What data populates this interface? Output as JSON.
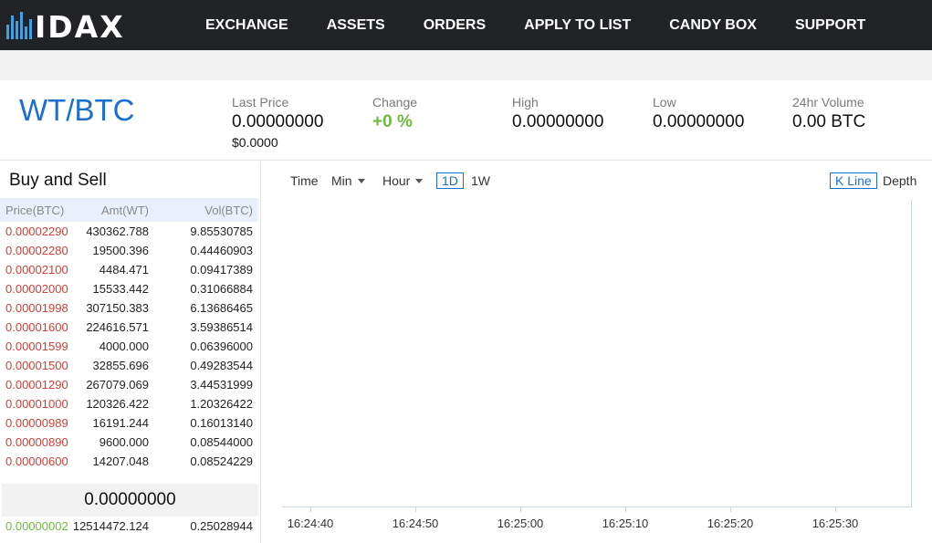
{
  "nav": {
    "logo": "IDAX",
    "items": [
      "EXCHANGE",
      "ASSETS",
      "ORDERS",
      "APPLY TO LIST",
      "CANDY BOX",
      "SUPPORT"
    ]
  },
  "ticker": {
    "pair": "WT/BTC",
    "last_price_label": "Last Price",
    "last_price": "0.00000000",
    "last_price_usd": "$0.0000",
    "change_label": "Change",
    "change": "+0 %",
    "high_label": "High",
    "high": "0.00000000",
    "low_label": "Low",
    "low": "0.00000000",
    "volume_label": "24hr Volume",
    "volume": "0.00 BTC"
  },
  "book": {
    "title": "Buy and Sell",
    "headers": [
      "Price(BTC)",
      "Amt(WT)",
      "Vol(BTC)"
    ],
    "asks": [
      [
        "0.00002290",
        "430362.788",
        "9.85530785"
      ],
      [
        "0.00002280",
        "19500.396",
        "0.44460903"
      ],
      [
        "0.00002100",
        "4484.471",
        "0.09417389"
      ],
      [
        "0.00002000",
        "15533.442",
        "0.31066884"
      ],
      [
        "0.00001998",
        "307150.383",
        "6.13686465"
      ],
      [
        "0.00001600",
        "224616.571",
        "3.59386514"
      ],
      [
        "0.00001599",
        "4000.000",
        "0.06396000"
      ],
      [
        "0.00001500",
        "32855.696",
        "0.49283544"
      ],
      [
        "0.00001290",
        "267079.069",
        "3.44531999"
      ],
      [
        "0.00001000",
        "120326.422",
        "1.20326422"
      ],
      [
        "0.00000989",
        "16191.244",
        "0.16013140"
      ],
      [
        "0.00000890",
        "9600.000",
        "0.08544000"
      ],
      [
        "0.00000600",
        "14207.048",
        "0.08524229"
      ]
    ],
    "last": "0.00000000",
    "bids": [
      [
        "0.00000002",
        "12514472.124",
        "0.25028944"
      ]
    ]
  },
  "chart_toolbar": {
    "time": "Time",
    "min": "Min",
    "hour": "Hour",
    "d1": "1D",
    "w1": "1W",
    "kline": "K Line",
    "depth": "Depth"
  },
  "chart_data": {
    "type": "line",
    "x": [
      "16:24:40",
      "16:24:50",
      "16:25:00",
      "16:25:10",
      "16:25:20",
      "16:25:30"
    ],
    "series": []
  },
  "colors": {
    "ask": "#d0403a",
    "bid": "#6dbb3f",
    "accent": "#1b6fd0",
    "nav_bg": "#222326"
  }
}
